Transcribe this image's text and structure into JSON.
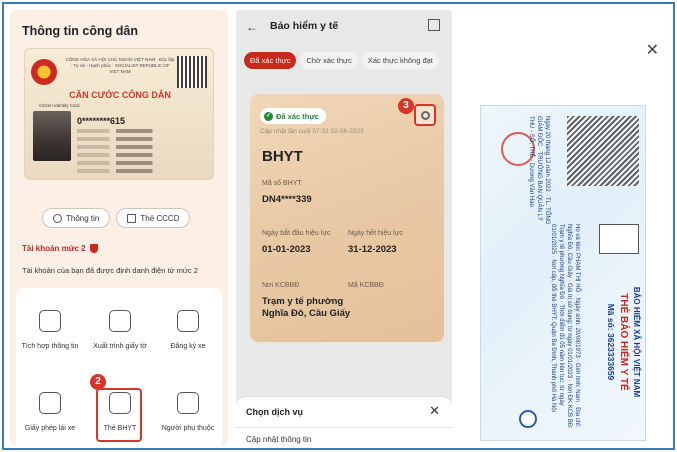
{
  "panel1": {
    "title": "Thông tin công dân",
    "id_card": {
      "header": "CỘNG HÒA XÃ HỘI CHỦ NGHĨA VIỆT NAM · Độc lập - Tự do - Hạnh phúc · SOCIALIST REPUBLIC OF VIET NAM",
      "title": "CĂN CƯỚC CÔNG DÂN",
      "subtitle": "Citizen Identity Card",
      "number": "0********615"
    },
    "buttons": {
      "info": "Thông tin",
      "cccd": "Thẻ CCCD"
    },
    "account_level": "Tài khoản mức 2",
    "account_desc": "Tài khoản của bạn đã được định danh điện tử mức 2",
    "menu": [
      "Tích hợp thông tin",
      "Xuất trình giấy tờ",
      "Đăng ký xe",
      "Giấy phép lái xe",
      "Thẻ BHYT",
      "Người phụ thuộc"
    ],
    "step_badge": "2"
  },
  "panel2": {
    "back_icon": "arrow-left-icon",
    "title": "Bảo hiểm y tế",
    "tabs": [
      "Đã xác thực",
      "Chờ xác thực",
      "Xác thực không đạt"
    ],
    "card": {
      "status": "Đã xác thực",
      "updated": "Cập nhật lần cuối 07:33 02-06-2023",
      "title": "BHYT",
      "code_label": "Mã số BHYT",
      "code_value": "DN4****339",
      "start_label": "Ngày bắt đầu hiệu lực",
      "start_value": "01-01-2023",
      "end_label": "Ngày hết hiệu lực",
      "end_value": "31-12-2023",
      "kcb_label": "Nơi KCBBĐ",
      "kcb_code_label": "Mã KCBBĐ",
      "kcb_value": "Trạm y tế phường Nghĩa Đô, Cầu Giấy"
    },
    "step_badge": "3",
    "sheet": {
      "title": "Chọn dịch vụ",
      "item": "Cập nhật thông tin"
    }
  },
  "panel3": {
    "close_icon": "close-icon",
    "card": {
      "org": "BẢO HIỂM XÃ HỘI VIỆT NAM",
      "title": "THẺ BẢO HIỂM Y TẾ",
      "number": "Mã số: 3623333659",
      "details": "Họ và tên: PHẠM THỊ HỒ · Ngày sinh: 20/08/1973 · Giới tính: Nam · Địa chỉ: Nghĩa Đô, Cầu Giấy · Giá trị sử dụng: từ ngày 01/01/2023 · Nơi ĐK KCB BĐ: Trạm y tế phường Nghĩa Đô · Thời điểm đủ 05 năm liên tục: từ ngày 01/01/2025 · Nơi cấp, đổi thẻ BHYT: Quận Ba Đình, Thành phố Hà Nội",
      "sign": "Ngày 20 tháng 12 năm 2022 · TL. TỔNG GIÁM ĐỐC · TRƯỞNG BAN QUẢN LÝ THU - SỔ, THẺ · Dương Văn Hào"
    }
  }
}
